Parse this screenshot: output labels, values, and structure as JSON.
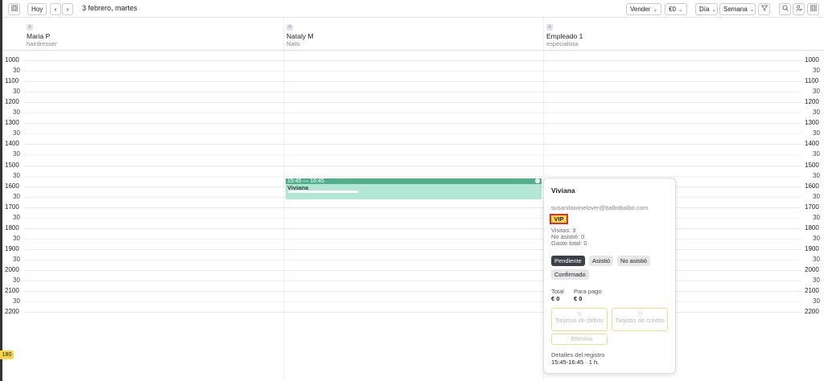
{
  "toolbar": {
    "grid_icon": "grid-icon",
    "today_label": "Hoy",
    "prev_icon": "chevron-left-icon",
    "next_icon": "chevron-right-icon",
    "date_label": "3 febrero, martes",
    "sell_label": "Vender",
    "money_label": "€0",
    "day_label": "Día",
    "week_label": "Semana",
    "filter_icon": "filter-icon",
    "zoom_icon": "zoom-icon",
    "user_icon": "user-settings-icon",
    "apps_icon": "apps-icon"
  },
  "staff": [
    {
      "badge": "A",
      "name": "Maria P",
      "role": "hairdresser"
    },
    {
      "badge": "A",
      "name": "Nataly M",
      "role": "Nails"
    },
    {
      "badge": "A",
      "name": "Empleado 1",
      "role": "especialista"
    }
  ],
  "times": [
    "1000",
    "30",
    "1100",
    "30",
    "1200",
    "30",
    "1300",
    "30",
    "1400",
    "30",
    "1500",
    "30",
    "1600",
    "30",
    "1700",
    "30",
    "1800",
    "30",
    "1900",
    "30",
    "2000",
    "30",
    "2100",
    "30",
    "2200"
  ],
  "event": {
    "time_range": "15:45 — 16:45",
    "client": "Viviana"
  },
  "popup": {
    "client_name": "Viviana",
    "email": "susanitawinelover@balbobalbo.com",
    "vip_label": "VIP",
    "visits": "Visitas: 3",
    "no_show": "No asistió: 0",
    "total_spent": "Gasto total: 0",
    "status_buttons": [
      "Pendiente",
      "Asistió",
      "No asistió",
      "Confirmado"
    ],
    "total_label": "Total",
    "total_value": "€ 0",
    "to_pay_label": "Para pago",
    "to_pay_value": "€ 0",
    "debit_label": "Tarjetas de débito",
    "credit_label": "Tarjetas de crédito",
    "cash_label": "Efectivo",
    "details_label": "Detalles del registro",
    "details_value": "15:45-16:45 · 1 h."
  },
  "pager_label": "180"
}
